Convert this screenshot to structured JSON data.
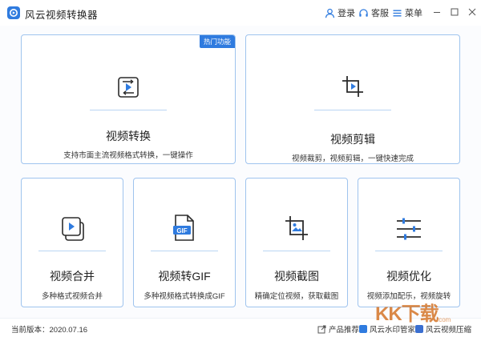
{
  "app": {
    "title": "风云视频转换器"
  },
  "titlebar": {
    "login": "登录",
    "service": "客服",
    "menu": "菜单"
  },
  "cards": {
    "convert": {
      "badge": "热门功能",
      "title": "视频转换",
      "desc": "支持市面主流视频格式转换，一键操作"
    },
    "edit": {
      "title": "视频剪辑",
      "desc": "视频裁剪，视频剪辑，一键快速完成"
    },
    "merge": {
      "title": "视频合并",
      "desc": "多种格式视频合并"
    },
    "gif": {
      "title": "视频转GIF",
      "desc": "多种视频格式转换成GIF",
      "icon_text": "GIF"
    },
    "capture": {
      "title": "视频截图",
      "desc": "精确定位视频，获取截图"
    },
    "optimize": {
      "title": "视频优化",
      "desc": "视频添加配乐，视频旋转"
    }
  },
  "footer": {
    "version": "当前版本：2020.07.16",
    "promo_label": "产品推荐：",
    "promo_1": "风云水印管家",
    "promo_2": "风云视频压缩"
  },
  "watermark": {
    "text": "KK下载",
    "sub": ".com"
  },
  "colors": {
    "accent": "#2f7bdf",
    "border": "#9fc4ee",
    "icon_dark": "#2b2b2b"
  }
}
